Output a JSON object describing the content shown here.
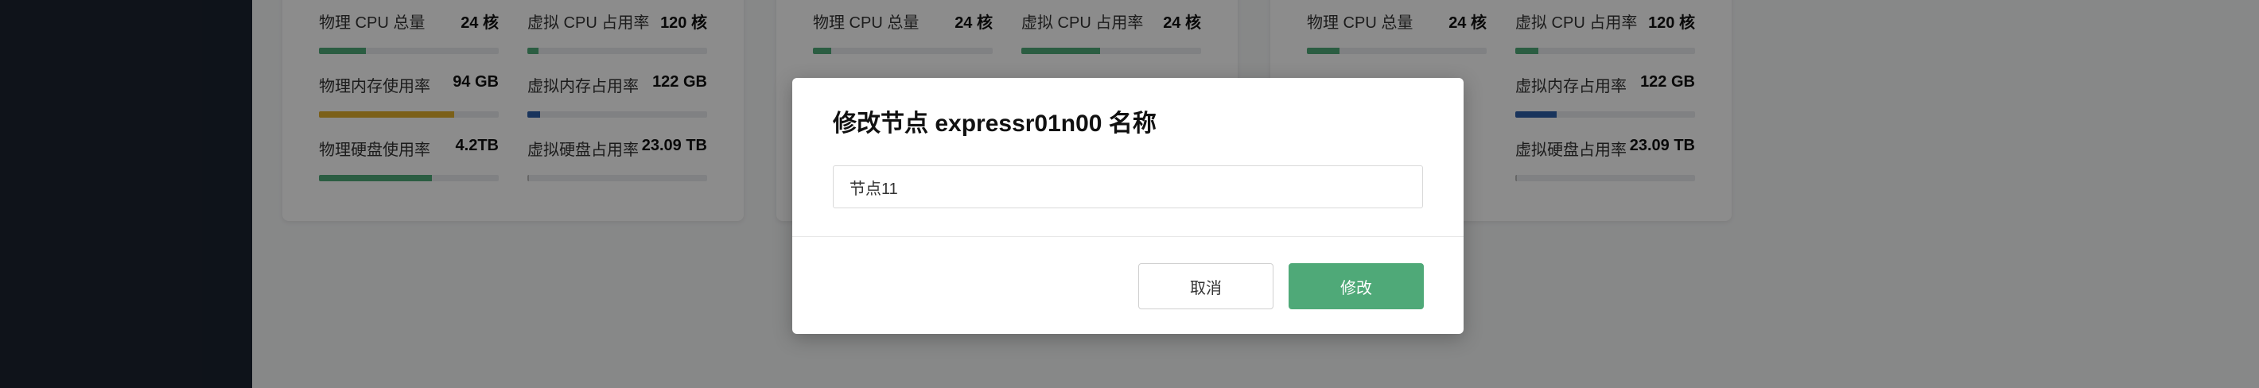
{
  "background": {
    "colors": {
      "cpu_bar": "#4fa978",
      "memory_bar_warning": "#e0b02e",
      "memory_bar_virtual": "#2f5fa8",
      "disk_bar": "#4fa978",
      "disk_bar_virtual": "#bbbbbb"
    },
    "cards": [
      {
        "metrics": [
          {
            "label": "物理 CPU 总量",
            "value": "24 核",
            "fill_fraction": 0.26
          },
          {
            "label": "虚拟 CPU 占用率",
            "value": "120 核",
            "fill_fraction": 0.06
          },
          {
            "label": "物理内存使用率",
            "value": "94 GB",
            "fill_fraction": 0.75
          },
          {
            "label": "虚拟内存占用率",
            "value": "122 GB",
            "fill_fraction": 0.07
          },
          {
            "label": "物理硬盘使用率",
            "value": "4.2TB",
            "fill_fraction": 0.63
          },
          {
            "label": "虚拟硬盘占用率",
            "value": "23.09 TB",
            "fill_fraction": 0.01
          }
        ]
      },
      {
        "metrics": [
          {
            "label": "物理 CPU 总量",
            "value": "24 核",
            "fill_fraction": 0.1
          },
          {
            "label": "虚拟 CPU 占用率",
            "value": "24 核",
            "fill_fraction": 0.44
          }
        ]
      },
      {
        "metrics": [
          {
            "label": "物理 CPU 总量",
            "value": "24 核",
            "fill_fraction": 0.18
          },
          {
            "label": "虚拟 CPU 占用率",
            "value": "120 核",
            "fill_fraction": 0.13
          },
          {
            "label": "虚拟内存占用率",
            "value": "122 GB",
            "fill_fraction": 0.23
          },
          {
            "label": "虚拟硬盘占用率",
            "value": "23.09 TB",
            "fill_fraction": 0.01
          }
        ]
      }
    ]
  },
  "dialog": {
    "title": "修改节点 expressr01n00 名称",
    "input_value": "节点11",
    "cancel_label": "取消",
    "submit_label": "修改"
  }
}
